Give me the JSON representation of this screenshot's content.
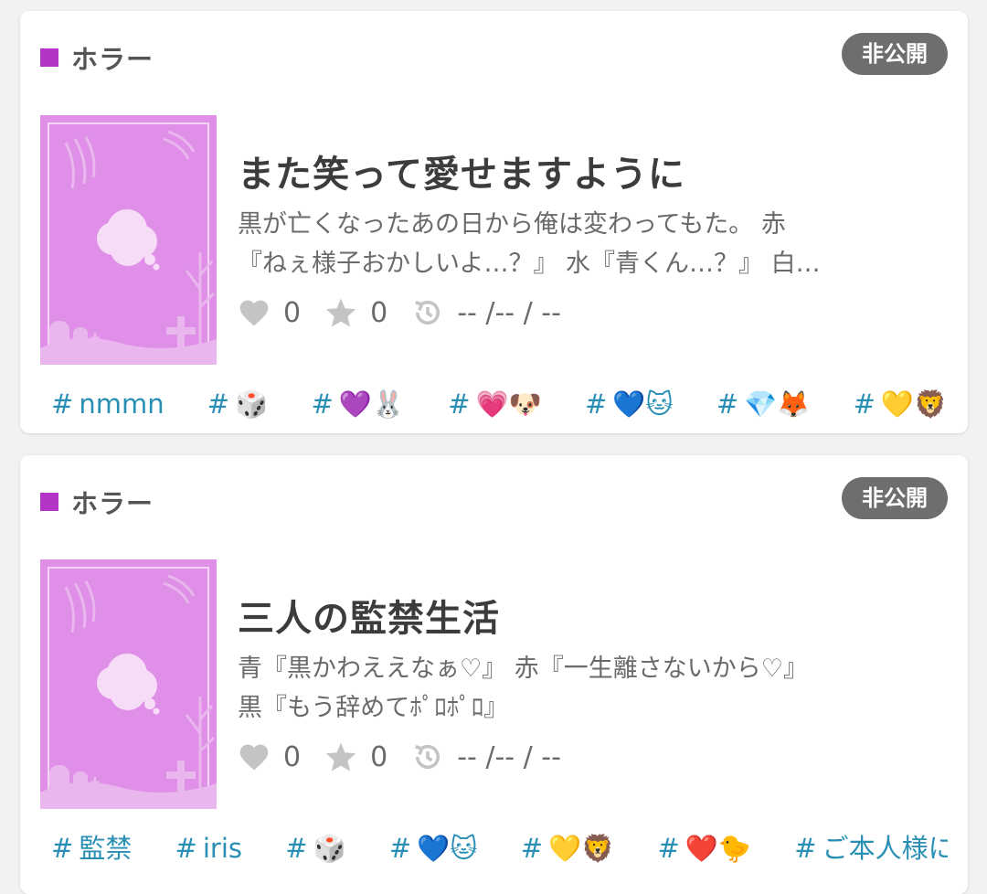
{
  "posts": [
    {
      "genre": "ホラー",
      "badge": "非公開",
      "title": "また笑って愛せますように",
      "desc_lines": [
        "黒が亡くなったあの日から俺は変わってもた。 赤",
        "『ねぇ様子おかしいよ…？』 水『青くん…？』 白…"
      ],
      "likes": "0",
      "stars": "0",
      "date": "-- /-- / --",
      "tags": [
        "nmmn",
        "🎲",
        "💜🐰",
        "💗🐶",
        "💙🐱",
        "💎🦊",
        "💛🦁",
        "❤️🐤"
      ]
    },
    {
      "genre": "ホラー",
      "badge": "非公開",
      "title": "三人の監禁生活",
      "desc_lines": [
        "青『黒かわええなぁ♡』 赤『一生離さないから♡』",
        "黒『もう辞めてﾎﾟﾛﾎﾟﾛ』"
      ],
      "likes": "0",
      "stars": "0",
      "date": "-- /-- / --",
      "tags": [
        "監禁",
        "iris",
        "🎲",
        "💙🐱",
        "💛🦁",
        "❤️🐤",
        "ご本人様には関係ありません"
      ]
    }
  ],
  "colors": {
    "genre": "#b534c8",
    "tag": "#2a8fb5",
    "badge": "#6e6e6e",
    "cover": "#e08fe8"
  },
  "icons": {
    "like": "heart-icon",
    "star": "star-icon",
    "date": "history-clock-icon"
  }
}
